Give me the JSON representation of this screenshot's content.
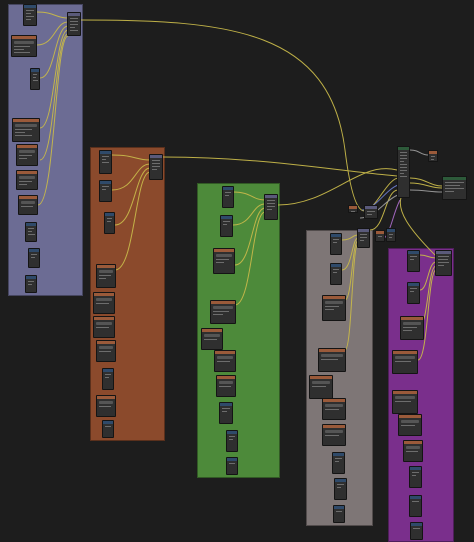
{
  "editor": {
    "name": "node-editor",
    "colors": {
      "background": "#1d1d1d",
      "wire_yellow": "#c7b84a",
      "wire_grey": "#a0a0a0",
      "wire_blue": "#6f7fcf",
      "wire_purple": "#b06fd0"
    }
  },
  "frames": [
    {
      "id": "frame-1",
      "label": "",
      "color": "#6c6c94"
    },
    {
      "id": "frame-2",
      "label": "",
      "color": "#8b4a2c"
    },
    {
      "id": "frame-3",
      "label": "",
      "color": "#4d8a3a"
    },
    {
      "id": "frame-4",
      "label": "",
      "color": "#7e7676"
    },
    {
      "id": "frame-5",
      "label": "",
      "color": "#7a2f8c"
    }
  ],
  "nodes_note": ""
}
